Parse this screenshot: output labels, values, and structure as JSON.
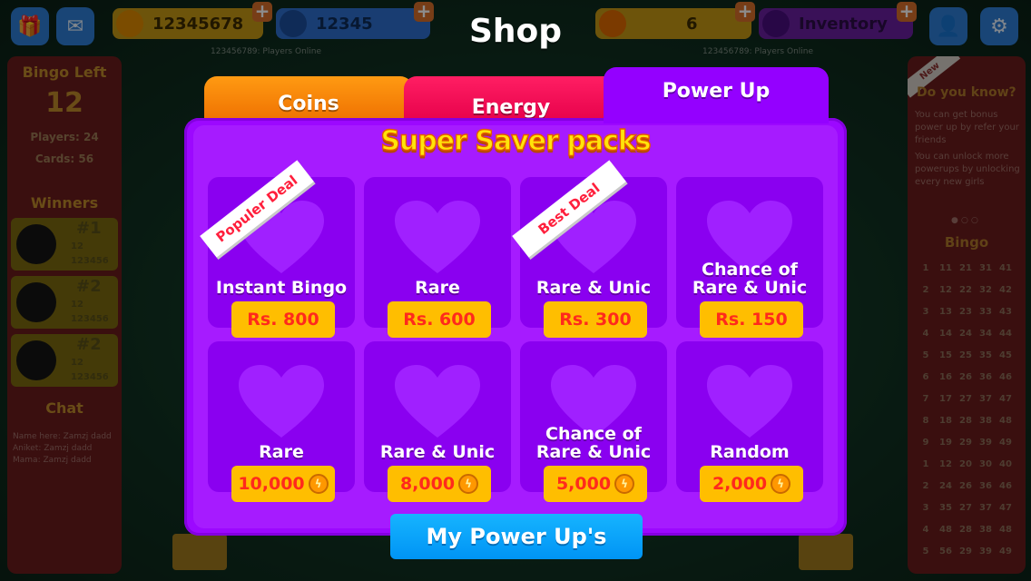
{
  "topbar": {
    "coins_value": "12345678",
    "energy_value": "12345",
    "powerups_value": "6",
    "inventory_label": "Inventory",
    "online_left": "123456789: Players Online",
    "online_right": "123456789: Players Online"
  },
  "left_panel": {
    "bingo_left_label": "Bingo Left",
    "bingo_left_value": "12",
    "players": "Players: 24",
    "cards": "Cards: 56",
    "winners_label": "Winners",
    "winners": [
      {
        "rank": "#1",
        "value": "12",
        "score": "123456"
      },
      {
        "rank": "#2",
        "value": "12",
        "score": "123456"
      },
      {
        "rank": "#2",
        "value": "12",
        "score": "123456"
      }
    ],
    "chat_label": "Chat",
    "chat_lines": [
      "Name here: Zamzj dadd",
      "Aniket: Zamzj dadd",
      "Mama: Zamzj dadd"
    ]
  },
  "right_panel": {
    "new_label": "New",
    "did_you_know": "Do you know?",
    "tips": [
      "You can get bonus power up by refer your friends",
      "You can unlock more powerups by unlocking every new girls"
    ],
    "bingo_label": "Bingo",
    "grid": [
      [
        "1",
        "11",
        "21",
        "31",
        "41"
      ],
      [
        "2",
        "12",
        "22",
        "32",
        "42"
      ],
      [
        "3",
        "13",
        "23",
        "33",
        "43"
      ],
      [
        "4",
        "14",
        "24",
        "34",
        "44"
      ],
      [
        "5",
        "15",
        "25",
        "35",
        "45"
      ],
      [
        "6",
        "16",
        "26",
        "36",
        "46"
      ],
      [
        "7",
        "17",
        "27",
        "37",
        "47"
      ],
      [
        "8",
        "18",
        "28",
        "38",
        "48"
      ],
      [
        "9",
        "19",
        "29",
        "39",
        "49"
      ],
      [
        "1",
        "12",
        "20",
        "30",
        "40"
      ],
      [
        "2",
        "24",
        "26",
        "36",
        "46"
      ],
      [
        "3",
        "35",
        "27",
        "37",
        "47"
      ],
      [
        "4",
        "48",
        "28",
        "38",
        "48"
      ],
      [
        "5",
        "56",
        "29",
        "39",
        "49"
      ]
    ]
  },
  "shop": {
    "title": "Shop",
    "tabs": [
      "Coins",
      "Energy",
      "Power Up"
    ],
    "active_tab": "Power Up",
    "section_title": "Super Saver packs",
    "cards": [
      {
        "label": "Instant Bingo",
        "price": "Rs. 800",
        "coin": false,
        "ribbon": "Populer Deal"
      },
      {
        "label": "Rare",
        "price": "Rs. 600",
        "coin": false,
        "ribbon": ""
      },
      {
        "label": "Rare & Unic",
        "price": "Rs. 300",
        "coin": false,
        "ribbon": "Best Deal"
      },
      {
        "label": "Chance of\nRare & Unic",
        "price": "Rs. 150",
        "coin": false,
        "ribbon": ""
      },
      {
        "label": "Rare",
        "price": "10,000",
        "coin": true,
        "ribbon": ""
      },
      {
        "label": "Rare & Unic",
        "price": "8,000",
        "coin": true,
        "ribbon": ""
      },
      {
        "label": "Chance of\nRare & Unic",
        "price": "5,000",
        "coin": true,
        "ribbon": ""
      },
      {
        "label": "Random",
        "price": "2,000",
        "coin": true,
        "ribbon": ""
      }
    ],
    "my_power_ups_label": "My Power Up's"
  },
  "icons": {
    "gift": "gift-icon",
    "mail": "mail-icon",
    "coin": "coin-icon",
    "energy": "lightning-icon",
    "powerup": "paw-icon",
    "inventory": "inventory-icon",
    "profile": "user-add-icon",
    "settings": "gear-icon",
    "heart": "heart-icon"
  },
  "colors": {
    "modal": "#9c08ff",
    "card": "#8a00f0",
    "heart": "#a020ff",
    "price_bg": "#ffbe00",
    "price_text": "#ff2a1c",
    "coins_tab": "#ff8a00",
    "energy_tab": "#ff1e63",
    "power_tab": "#9400ff",
    "cta": "#0aa6ff",
    "title_yellow": "#ffe40a"
  }
}
